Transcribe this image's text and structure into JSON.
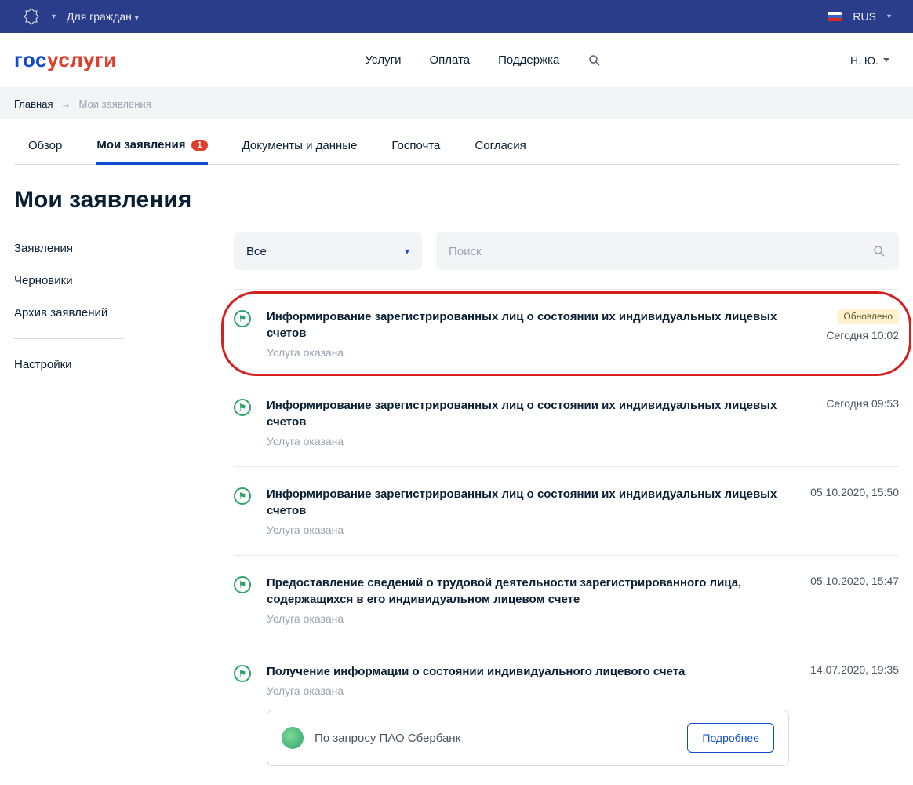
{
  "govbar": {
    "audience": "Для граждан",
    "lang": "RUS"
  },
  "logo": {
    "p1": "гос",
    "p2": "услуги"
  },
  "nav": {
    "services": "Услуги",
    "payment": "Оплата",
    "support": "Поддержка"
  },
  "user": {
    "short": "Н. Ю."
  },
  "breadcrumb": {
    "home": "Главная",
    "current": "Мои заявления"
  },
  "tabs": {
    "overview": "Обзор",
    "applications": "Мои заявления",
    "applications_badge": "1",
    "docs": "Документы и данные",
    "mail": "Госпочта",
    "consents": "Согласия"
  },
  "page_title": "Мои заявления",
  "sidebar": {
    "applications": "Заявления",
    "drafts": "Черновики",
    "archive": "Архив заявлений",
    "settings": "Настройки"
  },
  "filter": {
    "selected": "Все"
  },
  "search": {
    "placeholder": "Поиск"
  },
  "updated_label": "Обновлено",
  "items": [
    {
      "title": "Информирование зарегистрированных лиц о состоянии их индивидуальных лицевых счетов",
      "status": "Услуга оказана",
      "date": "Сегодня 10:02",
      "updated": true
    },
    {
      "title": "Информирование зарегистрированных лиц о состоянии их индивидуальных лицевых счетов",
      "status": "Услуга оказана",
      "date": "Сегодня 09:53",
      "updated": false
    },
    {
      "title": "Информирование зарегистрированных лиц о состоянии их индивидуальных лицевых счетов",
      "status": "Услуга оказана",
      "date": "05.10.2020, 15:50",
      "updated": false
    },
    {
      "title": "Предоставление сведений о трудовой деятельности зарегистрированного лица, содержащихся в его индивидуальном лицевом счете",
      "status": "Услуга оказана",
      "date": "05.10.2020, 15:47",
      "updated": false
    },
    {
      "title": "Получение информации о состоянии индивидуального лицевого счета",
      "status": "Услуга оказана",
      "date": "14.07.2020, 19:35",
      "updated": false
    }
  ],
  "extra": {
    "text": "По запросу ПАО Сбербанк",
    "button": "Подробнее"
  }
}
